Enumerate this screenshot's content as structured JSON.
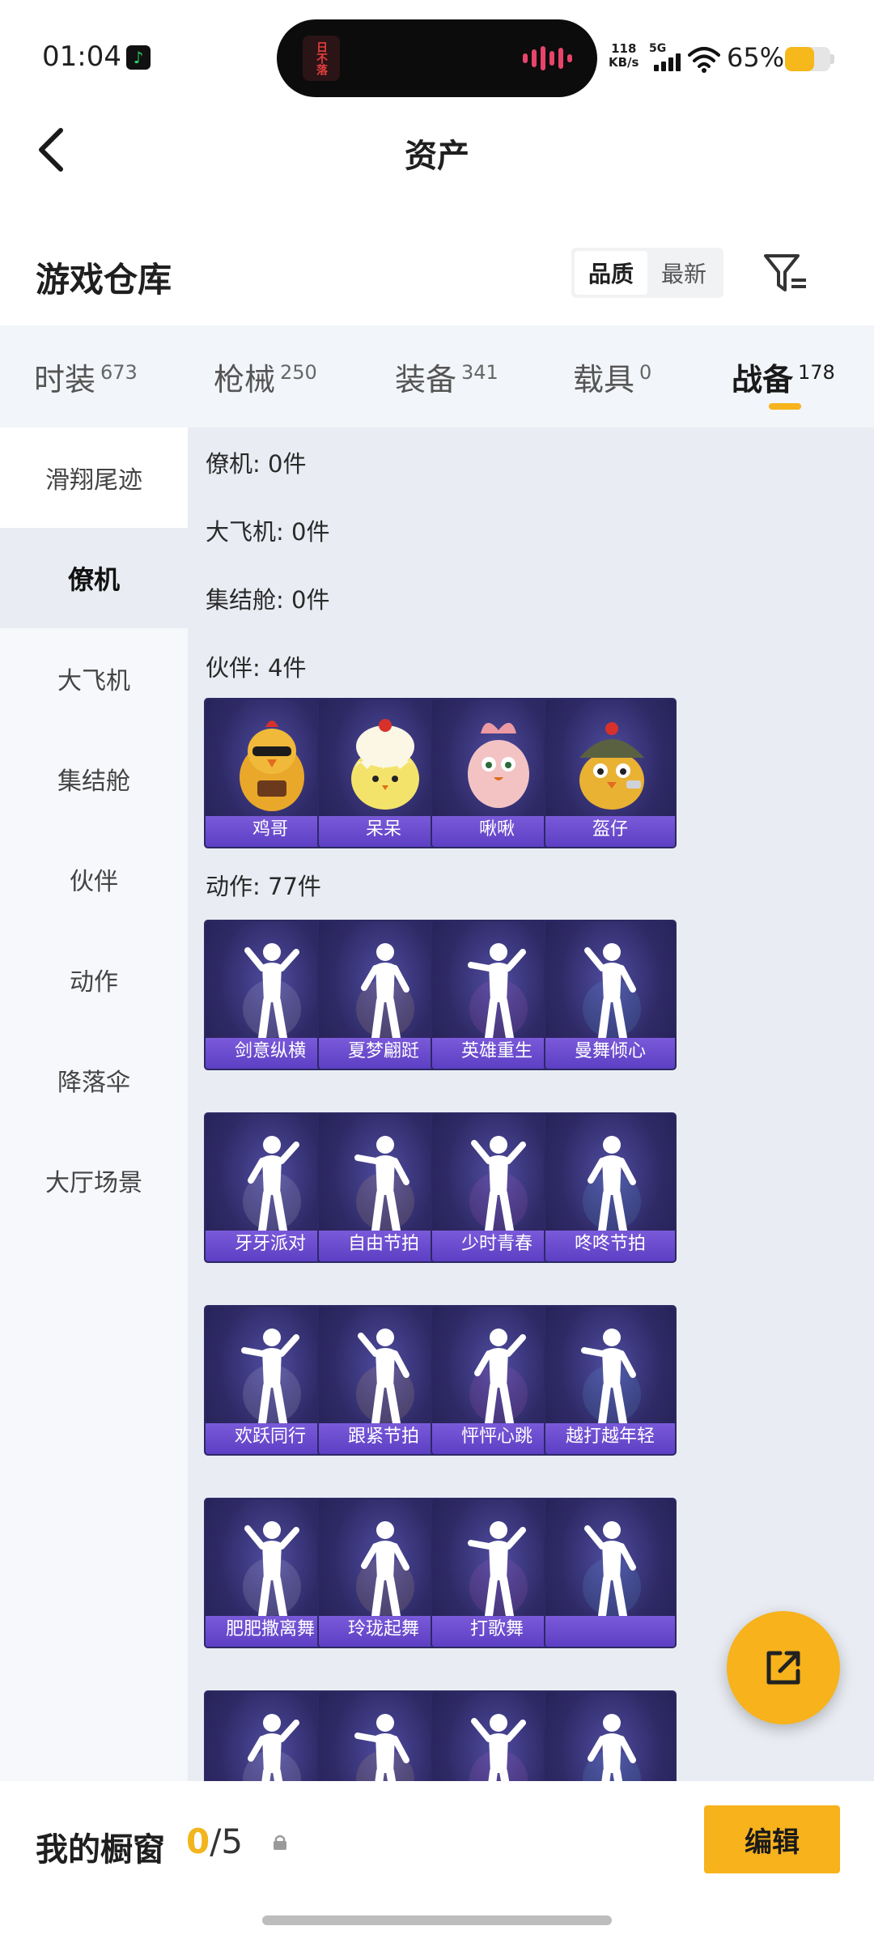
{
  "status": {
    "time": "01:04",
    "net_speed_value": "118",
    "net_speed_unit": "KB/s",
    "network_type": "5G",
    "battery_pct": "65%",
    "battery_level": 0.65,
    "island_text": "日不落",
    "colors": {
      "battery": "#f6b81a"
    }
  },
  "header": {
    "title": "资产",
    "back_icon": "chevron-left-icon"
  },
  "warehouse": {
    "title": "游戏仓库",
    "sort_options": [
      "品质",
      "最新"
    ],
    "sort_selected": "品质",
    "filter_icon": "filter-icon"
  },
  "category_tabs": [
    {
      "label": "时装",
      "count": "673"
    },
    {
      "label": "枪械",
      "count": "250"
    },
    {
      "label": "装备",
      "count": "341"
    },
    {
      "label": "载具",
      "count": "0"
    },
    {
      "label": "战备",
      "count": "178",
      "active": true
    }
  ],
  "side_nav": [
    {
      "label": "滑翔尾迹"
    },
    {
      "label": "僚机",
      "active": true
    },
    {
      "label": "大飞机"
    },
    {
      "label": "集结舱"
    },
    {
      "label": "伙伴"
    },
    {
      "label": "动作"
    },
    {
      "label": "降落伞"
    },
    {
      "label": "大厅场景"
    }
  ],
  "sections": [
    {
      "label": "僚机: 0件"
    },
    {
      "label": "大飞机: 0件"
    },
    {
      "label": "集结舱: 0件"
    },
    {
      "label": "伙伴: 4件"
    },
    {
      "label": "动作: 77件"
    }
  ],
  "companions": [
    {
      "name": "鸡哥",
      "icon": "chicken-sunglasses-icon"
    },
    {
      "name": "呆呆",
      "icon": "chick-icon"
    },
    {
      "name": "啾啾",
      "icon": "pink-bird-icon"
    },
    {
      "name": "盔仔",
      "icon": "chicken-helmet-icon"
    }
  ],
  "emotes": [
    {
      "name": "剑意纵横"
    },
    {
      "name": "夏梦翩跹"
    },
    {
      "name": "英雄重生"
    },
    {
      "name": "曼舞倾心"
    },
    {
      "name": "牙牙派对"
    },
    {
      "name": "自由节拍"
    },
    {
      "name": "少时青春"
    },
    {
      "name": "咚咚节拍"
    },
    {
      "name": "欢跃同行"
    },
    {
      "name": "跟紧节拍"
    },
    {
      "name": "怦怦心跳"
    },
    {
      "name": "越打越年轻"
    },
    {
      "name": "肥肥撒离舞"
    },
    {
      "name": "玲珑起舞"
    },
    {
      "name": "打歌舞"
    },
    {
      "name": ""
    },
    {
      "name": ""
    },
    {
      "name": ""
    },
    {
      "name": ""
    },
    {
      "name": ""
    }
  ],
  "fab": {
    "icon": "share-external-icon"
  },
  "bottom_bar": {
    "label": "我的橱窗",
    "current": "0",
    "separator": "/",
    "max": "5",
    "lock_icon": "lock-icon",
    "edit_label": "编辑"
  },
  "colors": {
    "accent": "#f7b21c",
    "card_bg": "#2f2a66",
    "card_stripe": "#6a4bd0"
  }
}
